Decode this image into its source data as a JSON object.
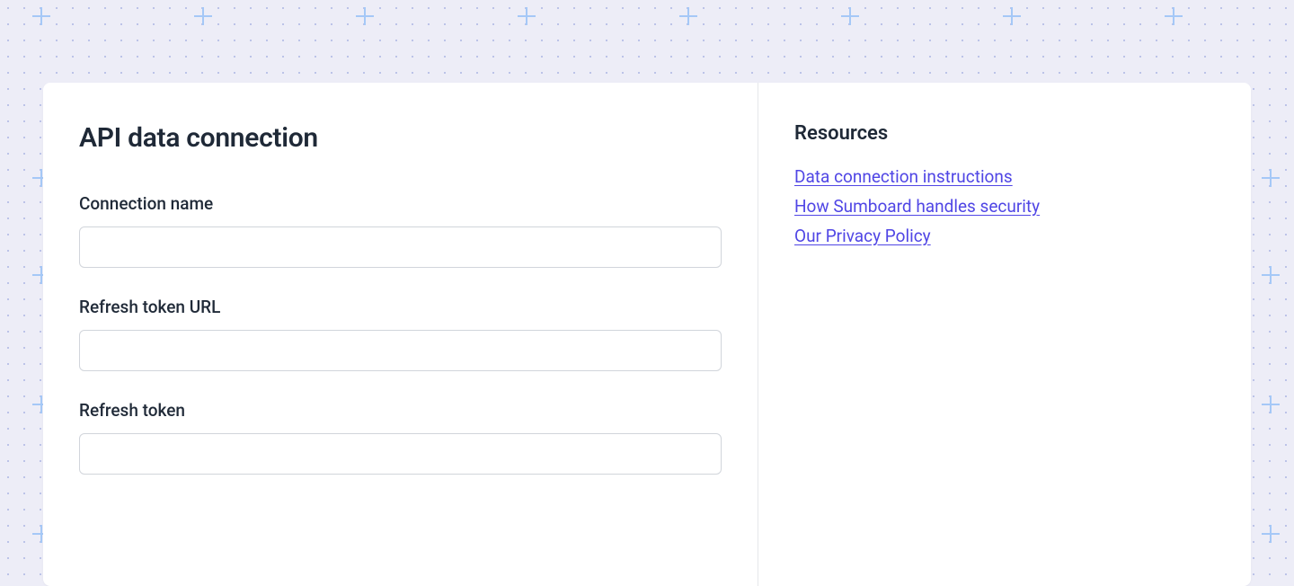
{
  "main": {
    "title": "API data connection",
    "fields": {
      "connection_name": {
        "label": "Connection name",
        "value": ""
      },
      "refresh_token_url": {
        "label": "Refresh token URL",
        "value": ""
      },
      "refresh_token": {
        "label": "Refresh token",
        "value": ""
      }
    }
  },
  "sidebar": {
    "title": "Resources",
    "links": [
      "Data connection instructions",
      "How Sumboard handles security",
      "Our Privacy Policy"
    ]
  }
}
